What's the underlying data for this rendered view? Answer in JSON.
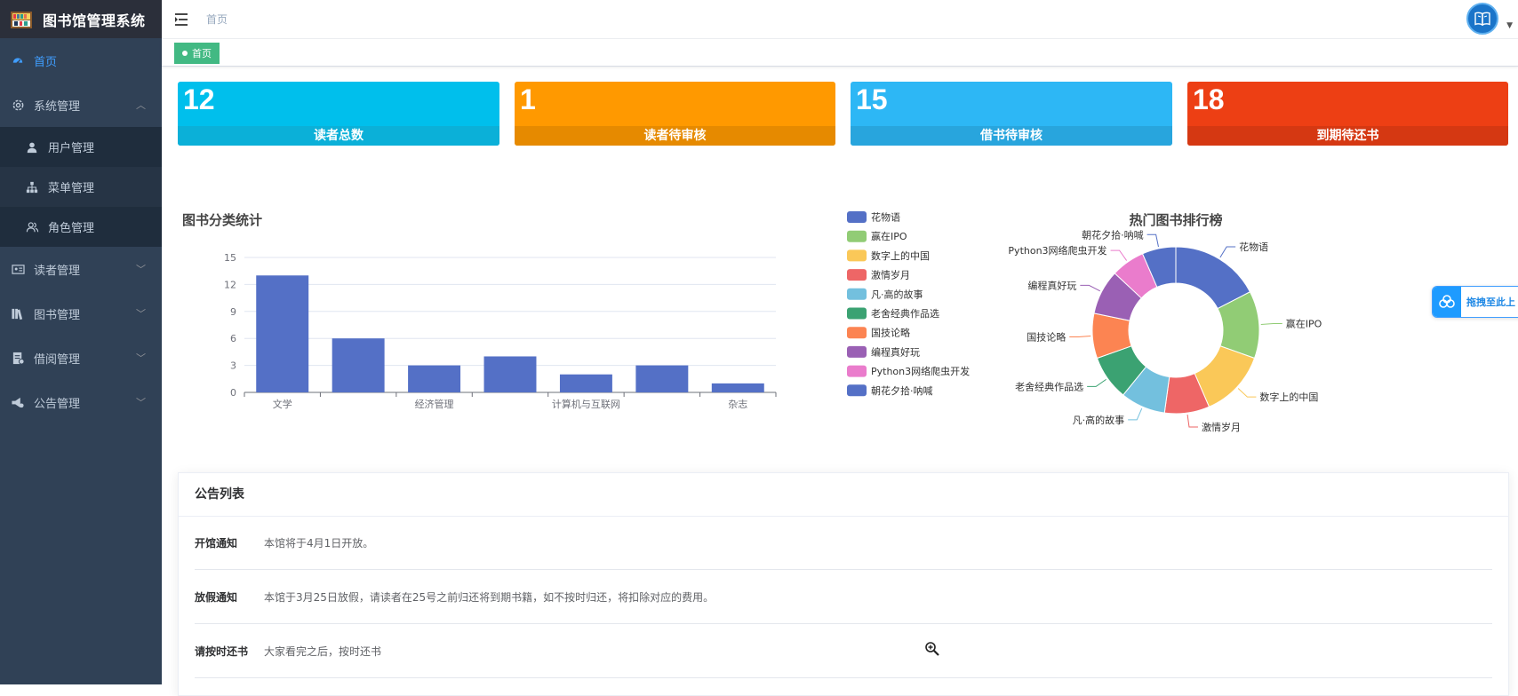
{
  "app": {
    "title": "图书馆管理系统"
  },
  "sidebar": {
    "items": [
      {
        "label": "首页",
        "icon": "dashboard-icon",
        "active": true
      },
      {
        "label": "系统管理",
        "icon": "gear-icon",
        "expanded": true,
        "children": [
          {
            "label": "用户管理",
            "icon": "user-icon"
          },
          {
            "label": "菜单管理",
            "icon": "tree-icon"
          },
          {
            "label": "角色管理",
            "icon": "peoples-icon"
          }
        ]
      },
      {
        "label": "读者管理",
        "icon": "id-card-icon"
      },
      {
        "label": "图书管理",
        "icon": "books-icon"
      },
      {
        "label": "借阅管理",
        "icon": "document-icon"
      },
      {
        "label": "公告管理",
        "icon": "megaphone-icon"
      }
    ]
  },
  "navbar": {
    "breadcrumb": "首页"
  },
  "tags": {
    "home": "首页"
  },
  "stats": [
    {
      "value": "12",
      "label": "读者总数",
      "color": "#00bfec",
      "label_bg": "#0bb0d8"
    },
    {
      "value": "1",
      "label": "读者待审核",
      "color": "#ff9900",
      "label_bg": "#e68a00"
    },
    {
      "value": "15",
      "label": "借书待审核",
      "color": "#2db7f5",
      "label_bg": "#28a5dd"
    },
    {
      "value": "18",
      "label": "到期待还书",
      "color": "#ed3f14",
      "label_bg": "#d53812"
    }
  ],
  "chart_data": [
    {
      "type": "bar",
      "title": "图书分类统计",
      "categories": [
        "文学",
        "",
        "经济管理",
        "",
        "计算机与互联网",
        "",
        "杂志"
      ],
      "values": [
        13,
        6,
        3,
        4,
        2,
        3,
        1
      ],
      "ylim": [
        0,
        15
      ],
      "yticks": [
        0,
        3,
        6,
        9,
        12,
        15
      ],
      "color": "#5470c6",
      "grid": true
    },
    {
      "type": "pie",
      "title": "热门图书排行榜",
      "donut": true,
      "legend_position": "left",
      "labels": [
        "花物语",
        "赢在IPO",
        "数字上的中国",
        "激情岁月",
        "凡·高的故事",
        "老舍经典作品选",
        "国技论略",
        "编程真好玩",
        "Python3网络爬虫开发",
        "朝花夕拾·呐喊"
      ],
      "values": [
        8,
        6,
        6,
        4,
        4,
        4,
        4,
        4,
        3,
        3
      ],
      "colors": [
        "#5470c6",
        "#91cc75",
        "#fac858",
        "#ee6666",
        "#73c0de",
        "#3ba272",
        "#fc8452",
        "#9a60b4",
        "#ea7ccc",
        "#5470c6"
      ]
    }
  ],
  "drag_hint": {
    "text": "拖拽至此上"
  },
  "notices": {
    "title": "公告列表",
    "rows": [
      {
        "title": "开馆通知",
        "content": "本馆将于4月1日开放。"
      },
      {
        "title": "放假通知",
        "content": "本馆于3月25日放假，请读者在25号之前归还将到期书籍，如不按时归还，将扣除对应的费用。"
      },
      {
        "title": "请按时还书",
        "content": "大家看完之后，按时还书"
      }
    ]
  }
}
